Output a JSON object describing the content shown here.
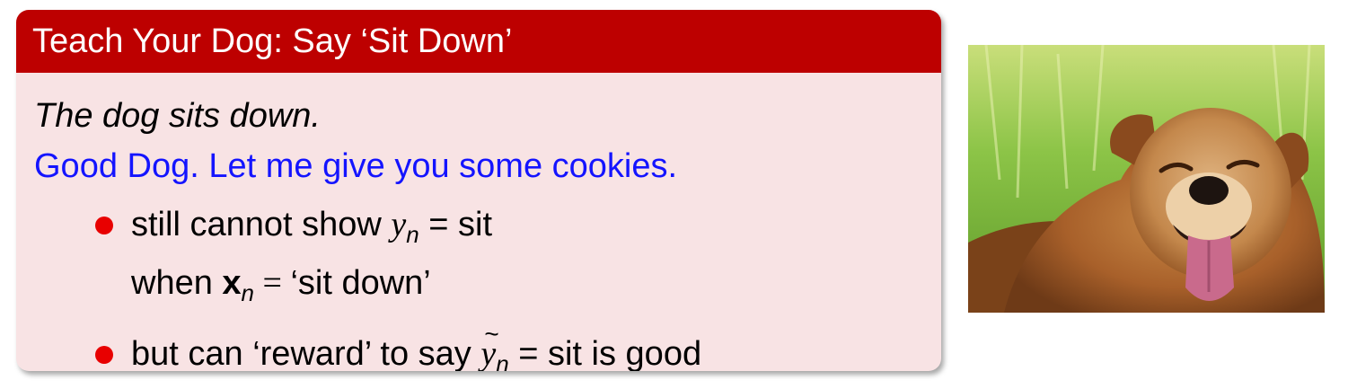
{
  "slide": {
    "title": "Teach Your Dog: Say ‘Sit Down’",
    "line1": "The dog sits down.",
    "line2": "Good Dog. Let me give you some cookies.",
    "bullet1": {
      "pre": "still cannot show ",
      "var": "y",
      "sub": "n",
      "post": " = sit",
      "l2_pre": "when ",
      "l2_var": "x",
      "l2_sub": "n",
      "l2_eq": " = ",
      "l2_post": "‘sit down’"
    },
    "bullet2": {
      "pre": "but can ‘reward’ to say ",
      "tilde": "~",
      "var": "y",
      "sub": "n",
      "post": " = sit is good"
    }
  },
  "colors": {
    "header": "#bd0000",
    "body_bg": "#f8e3e4",
    "accent_blue": "#1414ff",
    "bullet": "#e80000"
  },
  "image": {
    "subject": "dog-photo"
  }
}
